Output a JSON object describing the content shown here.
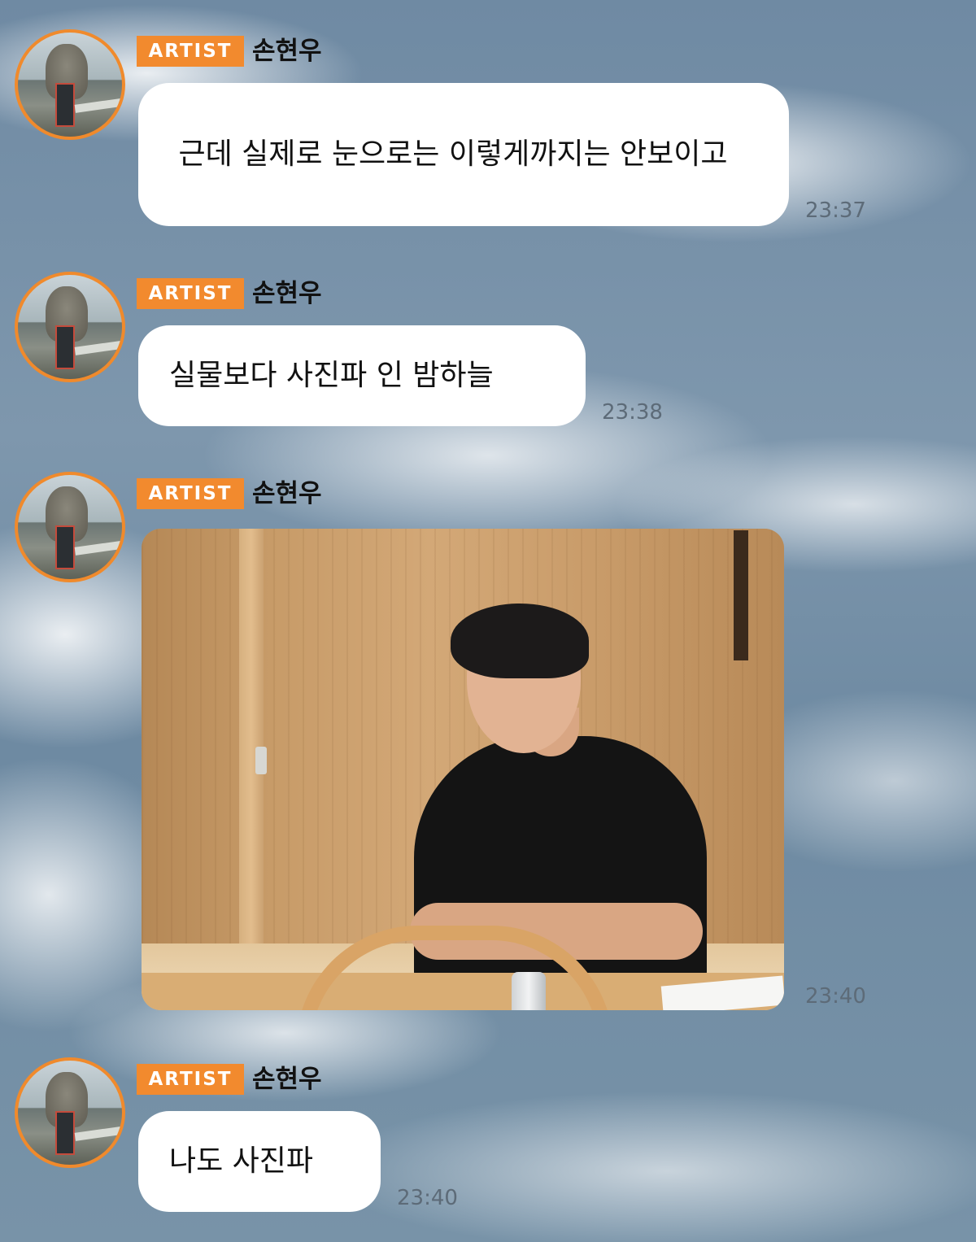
{
  "messages": [
    {
      "badge": "ARTIST",
      "sender": "손현우",
      "text": " 근데 실제로 눈으로는 이렇게까지는 안보이고",
      "time": "23:37"
    },
    {
      "badge": "ARTIST",
      "sender": "손현우",
      "text": "실물보다 사진파 인 밤하늘",
      "time": "23:38"
    },
    {
      "badge": "ARTIST",
      "sender": "손현우",
      "type": "photo",
      "time": "23:40"
    },
    {
      "badge": "ARTIST",
      "sender": "손현우",
      "text": "나도 사진파",
      "time": "23:40"
    }
  ],
  "colors": {
    "badge": "#f28a2e",
    "avatar_ring": "#f08a2c",
    "bubble": "#ffffff",
    "timestamp": "#5d6b78"
  }
}
